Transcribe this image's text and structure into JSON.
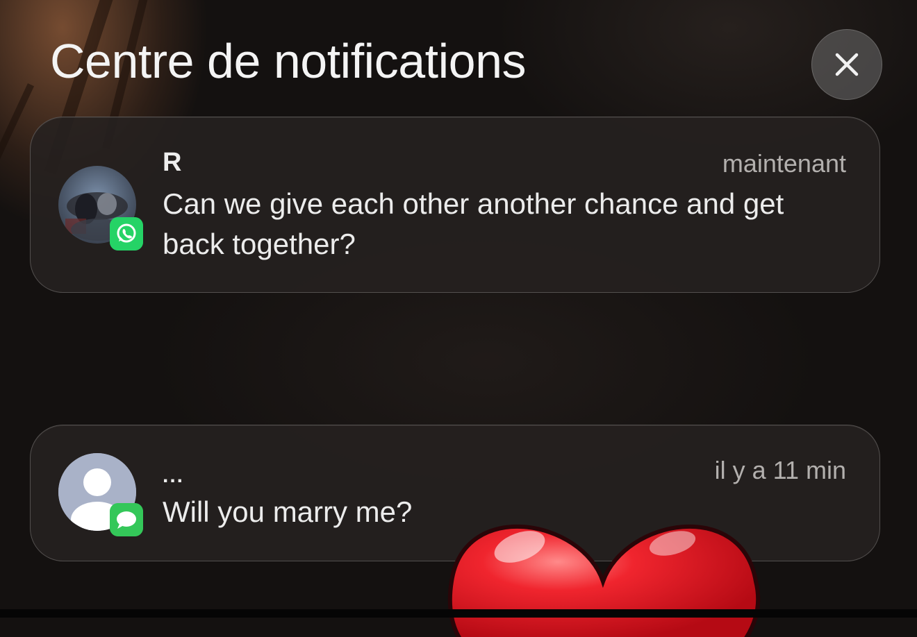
{
  "header": {
    "title": "Centre de notifications",
    "close_icon": "close-icon"
  },
  "notifications": [
    {
      "sender": "R",
      "time": "maintenant",
      "message": "Can we give each other another chance and get back together?",
      "app_icon": "whatsapp-icon",
      "app_color": "#25D366"
    },
    {
      "sender": "...",
      "time": "il y a 11 min",
      "message": "Will you marry me?",
      "app_icon": "messages-icon",
      "app_color": "#34C759"
    }
  ],
  "overlay": {
    "sticker": "red-heart-icon",
    "color": "#E0101C"
  }
}
